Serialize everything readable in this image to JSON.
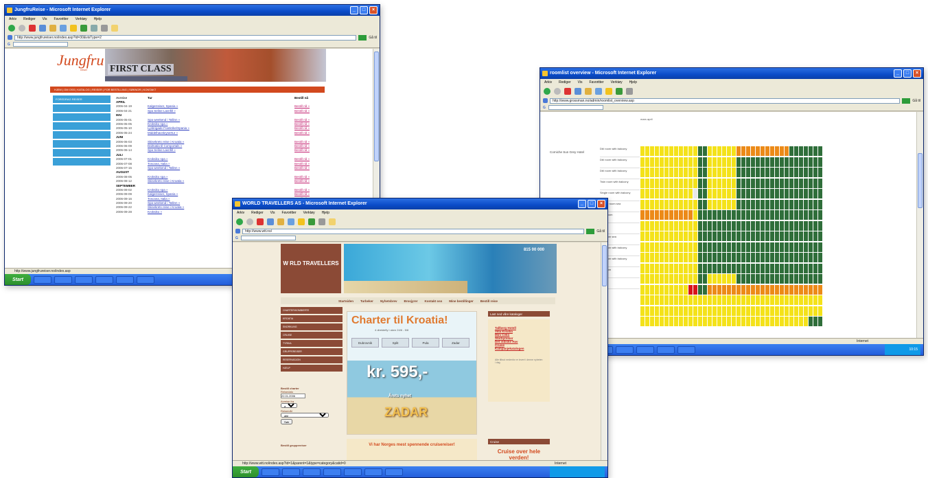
{
  "jungfru": {
    "title": "JungfruReise - Microsoft Internet Explorer",
    "menu": [
      "Arkiv",
      "Rediger",
      "Vis",
      "Favoritter",
      "Verktøy",
      "Hjelp"
    ],
    "address": "http://www.jungfrureiser.no/index.asp?id=30&visType=2",
    "go_label": "Gå til",
    "logo": "Jungfru",
    "logo_sub": "reiser",
    "banner_text": "FIRST CLASS",
    "nav": "HJEM | OM OSS | KATALOG | REISER | FOR BESTILLING | SØKNOR | KONTAKT",
    "sidebar_header": "FOREDRAG REISER",
    "table_headers": [
      "Avreise",
      "Tur",
      "Bestill nå"
    ],
    "rows": [
      {
        "type": "month",
        "label": "APRIL"
      },
      {
        "date": "2006-04-19",
        "tour": "Kalgerreiser, Spania »",
        "book": "Bestill nå »"
      },
      {
        "date": "2006-04-21",
        "tour": "Spa Seline Lavnfill »",
        "book": "Bestill nå »"
      },
      {
        "type": "month",
        "label": "MAI"
      },
      {
        "date": "2006-05-01",
        "tour": "Spa weekend i Tallinn »",
        "book": "Bestill nå »"
      },
      {
        "date": "2006-05-05",
        "tour": "Kroksiko spa »",
        "book": "Bestill nå »"
      },
      {
        "date": "2006-05-10",
        "tour": "Lysbrigade Frankrike/Spania »",
        "book": "Bestill nå »"
      },
      {
        "date": "2006-05-24",
        "tour": "Middelhavskrysertur »",
        "book": "Bestill nå »"
      },
      {
        "type": "month",
        "label": "JUNI"
      },
      {
        "date": "2006-06-03",
        "tour": "Skisekrets reise i Kroatia »",
        "book": "Bestill nå »"
      },
      {
        "date": "2006-06-09",
        "tour": "Dalmatia til Comportals »",
        "book": "Bestill nå »"
      },
      {
        "date": "2006-06-14",
        "tour": "Spa Seline Lavnfill »",
        "book": "Bestill nå »"
      },
      {
        "type": "month",
        "label": "JULI"
      },
      {
        "date": "2006-07-01",
        "tour": "Kroksiko spa »",
        "book": "Bestill nå »"
      },
      {
        "date": "2006-07-08",
        "tour": "Toscana, Italia »",
        "book": "Bestill nå »"
      },
      {
        "date": "2006-07-15",
        "tour": "Spa weekend i Tallinn »",
        "book": "Bestill nå »"
      },
      {
        "type": "month",
        "label": "AUGUST"
      },
      {
        "date": "2006-08-05",
        "tour": "Kroksiko spa »",
        "book": "Bestill nå »"
      },
      {
        "date": "2006-08-12",
        "tour": "Skisekrets reise i Kroatia »",
        "book": "Bestill nå »"
      },
      {
        "type": "month",
        "label": "SEPTEMBER"
      },
      {
        "date": "2006-09-02",
        "tour": "Kroksiko spa »",
        "book": "Bestill nå »"
      },
      {
        "date": "2006-09-09",
        "tour": "Kalgerreiser, Spania »",
        "book": "Bestill nå »"
      },
      {
        "date": "2006-09-16",
        "tour": "Toscana, Italia »",
        "book": "Bestill nå »"
      },
      {
        "date": "2006-09-20",
        "tour": "Spa weekend i Tallinn »",
        "book": "Bestill nå »"
      },
      {
        "date": "2006-09-22",
        "tour": "Skisekrets reise i Kroatia »",
        "book": "Bestill nå »"
      },
      {
        "date": "2006-09-28",
        "tour": "Kroksiko »",
        "book": "Bestill nå »"
      }
    ],
    "status": "http://www.jungfrureiser.no/index.asp",
    "taskbar": {
      "start": "Start",
      "tasks": [
        "",
        "",
        "",
        "",
        "",
        "",
        "",
        "",
        ""
      ]
    }
  },
  "calendar": {
    "title": "roomlist overview - Microsoft Internet Explorer",
    "menu": [
      "Arkiv",
      "Rediger",
      "Vis",
      "Favoritter",
      "Verktøy",
      "Hjelp"
    ],
    "address": "http://www.grossman.no/admin/roomlist_overview.asp",
    "go_label": "Gå til",
    "months": "mars                              april",
    "hotel": "Corniche Sun Grey Hotel",
    "room_labels": [
      "Dbl room with balcony",
      "Dbl room with balcony",
      "Dbl room with balcony",
      "Twin room with balcony",
      "Single room with balcony",
      "Deluxe room sea",
      "Twin room",
      "Suite",
      "Dbl room sea",
      "Dbl room with balcony",
      "Dbl room with balcony",
      "Dbl room",
      "Suite"
    ],
    "status": "Internet",
    "taskbar": {
      "tray_time": "10:15"
    }
  },
  "worldtravel": {
    "title": "WORLD TRAVELLERS AS - Microsoft Internet Explorer",
    "menu": [
      "Arkiv",
      "Rediger",
      "Vis",
      "Favoritter",
      "Verktøy",
      "Hjelp"
    ],
    "address": "http://www.wtt.no/",
    "go_label": "Gå til",
    "logo": "W RLD TRAVELLERS",
    "phone": "815 00 000",
    "nav": [
      "Startsiden",
      "Turbeker",
      "Nyhetsbrev",
      "Brosjyrer",
      "Kontakt oss",
      "Mine bestillinger",
      "Bestill reise"
    ],
    "sidebar": [
      "CHARTER/KOMBIERTE",
      "KROATIA",
      "SNORKLING",
      "CRUISE",
      "TYRKIA",
      "GRUPPEREISER",
      "RESERVASJON",
      "HJELP"
    ],
    "form": {
      "title": "Bestill charter",
      "date_label": "Reisedato",
      "date_value": "22.01.2006",
      "from_label": "Avreise fra",
      "from_value": "alle",
      "dest_label": "Reisemål",
      "dest_value": "alle",
      "submit": "Søk",
      "footer": "Bestill gruppereiser"
    },
    "ad": {
      "title": "Charter til Kroatia!",
      "sub": "4 direktefly i uken 24/6 - 5/8",
      "tabs": [
        "Dubrovnik",
        "Split",
        "Pula",
        "Zadar"
      ],
      "price": "kr. 595,-",
      "offer": "Årets nyhet",
      "dest": "ZADAR"
    },
    "ad2": "Vi har Norges mest spennende cruisereiser!",
    "right_head": "Last ned våre kataloger",
    "right_links": [
      "Tallberg Hotell",
      "Villa Kroatia",
      "Mini Ceko",
      "Storbyreiser",
      "Det indiske Hav",
      "Cruise",
      "Kampanjekatalogen"
    ],
    "right_note": "Alle tilbud nedenfor er levert i denne nyheten i dag",
    "cruise_head": "Cruise",
    "cruise_text": "Cruise over hele verden!",
    "status": "http://www.wtt.no/index.asp?id=1&parent=1&type=category&catid=0",
    "status_zone": "Internet",
    "taskbar": {
      "start": "Start"
    }
  }
}
